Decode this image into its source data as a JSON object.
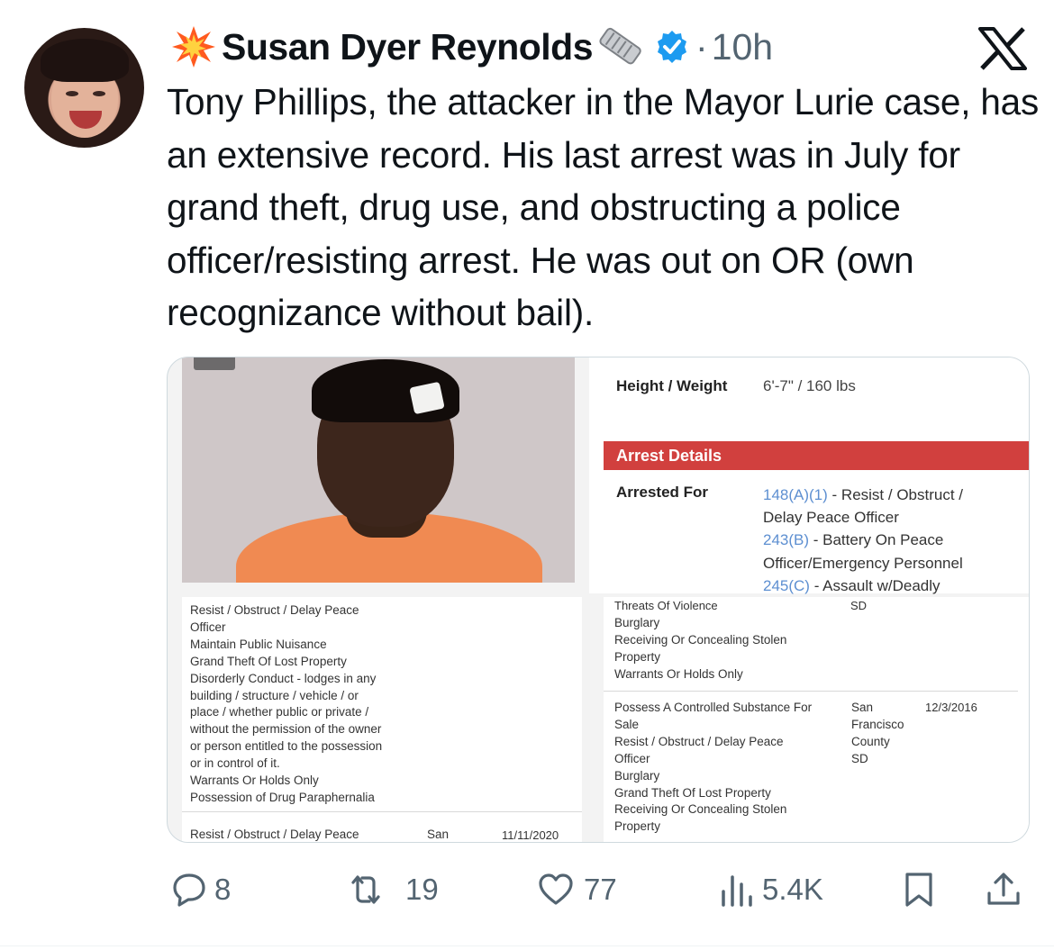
{
  "author": {
    "name": "Susan Dyer Reynolds",
    "separator": "·",
    "time": "10h",
    "prefix_emoji": "collision-emoji",
    "suffix_emoji": "newspaper-emoji",
    "verified_color": "#1d9bf0"
  },
  "tweet": {
    "text": "Tony Phillips, the attacker in the Mayor Lurie case, has an extensive record. His last arrest was in July for grand theft, drug use, and obstructing a police officer/resisting arrest. He was out on OR (own recognizance without bail)."
  },
  "media": {
    "height_weight_label": "Height / Weight",
    "height_weight_value": "6'-7\" / 160 lbs",
    "arrest_details_title": "Arrest Details",
    "arrest_details_color": "#d1403e",
    "arrested_for_label": "Arrested For",
    "charges": [
      {
        "code": "148(A)(1)",
        "text": " - Resist / Obstruct /"
      },
      {
        "text": "Delay Peace Officer"
      },
      {
        "code": "243(B)",
        "text": " - Battery On Peace"
      },
      {
        "text": "Officer/Emergency Personnel"
      },
      {
        "code": "245(C)",
        "text": " - Assault w/Deadly"
      }
    ],
    "left_list": [
      "Resist / Obstruct / Delay Peace",
      "Officer",
      "Maintain Public Nuisance",
      "Grand Theft Of Lost Property",
      "Disorderly Conduct - lodges in any",
      "building / structure / vehicle / or",
      "place / whether public or private /",
      "without the permission of the owner",
      "or person entitled to the possession",
      "or in control of it.",
      "Warrants Or Holds Only",
      "Possession of Drug Paraphernalia"
    ],
    "left_row": {
      "offense": "Resist / Obstruct / Delay Peace",
      "county": "San",
      "date": "11/11/2020"
    },
    "right_cut": "Threats Of Violence",
    "right_cut_county": "SD",
    "right_list1": [
      "Burglary",
      "Receiving Or Concealing Stolen",
      "Property",
      "Warrants Or Holds Only"
    ],
    "right_list2": [
      "Possess A Controlled Substance For",
      "Sale",
      "Resist / Obstruct / Delay Peace",
      "Officer",
      "Burglary",
      "Grand Theft Of Lost Property",
      "Receiving Or Concealing Stolen",
      "Property"
    ],
    "right_county": [
      "San",
      "Francisco",
      "County",
      "SD"
    ],
    "right_date": "12/3/2016"
  },
  "actions": {
    "replies": "8",
    "reposts": "19",
    "likes": "77",
    "views": "5.4K",
    "repost_color": "#536471"
  }
}
